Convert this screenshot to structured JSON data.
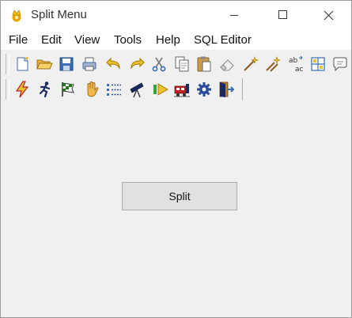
{
  "window": {
    "title": "Split Menu"
  },
  "menu": {
    "items": [
      "File",
      "Edit",
      "View",
      "Tools",
      "Help",
      "SQL Editor"
    ]
  },
  "toolbar1": {
    "icons": [
      "new-file-icon",
      "open-folder-icon",
      "save-icon",
      "print-icon",
      "undo-icon",
      "redo-icon",
      "cut-icon",
      "copy-icon",
      "paste-icon",
      "eraser-icon",
      "wand-icon",
      "wands-icon",
      "spellcheck-icon",
      "grid-icon",
      "speech-bubble-icon"
    ]
  },
  "toolbar2": {
    "icons": [
      "lightning-icon",
      "running-man-icon",
      "checkered-flag-icon",
      "hand-icon",
      "list-icon",
      "telescope-icon",
      "play-forward-icon",
      "train-icon",
      "gear-icon",
      "exit-door-icon"
    ]
  },
  "button": {
    "label": "Split"
  },
  "colors": {
    "window_bg": "#f0f0f0",
    "titlebar_bg": "#ffffff",
    "button_bg": "#e1e1e1",
    "button_border": "#adadad"
  }
}
